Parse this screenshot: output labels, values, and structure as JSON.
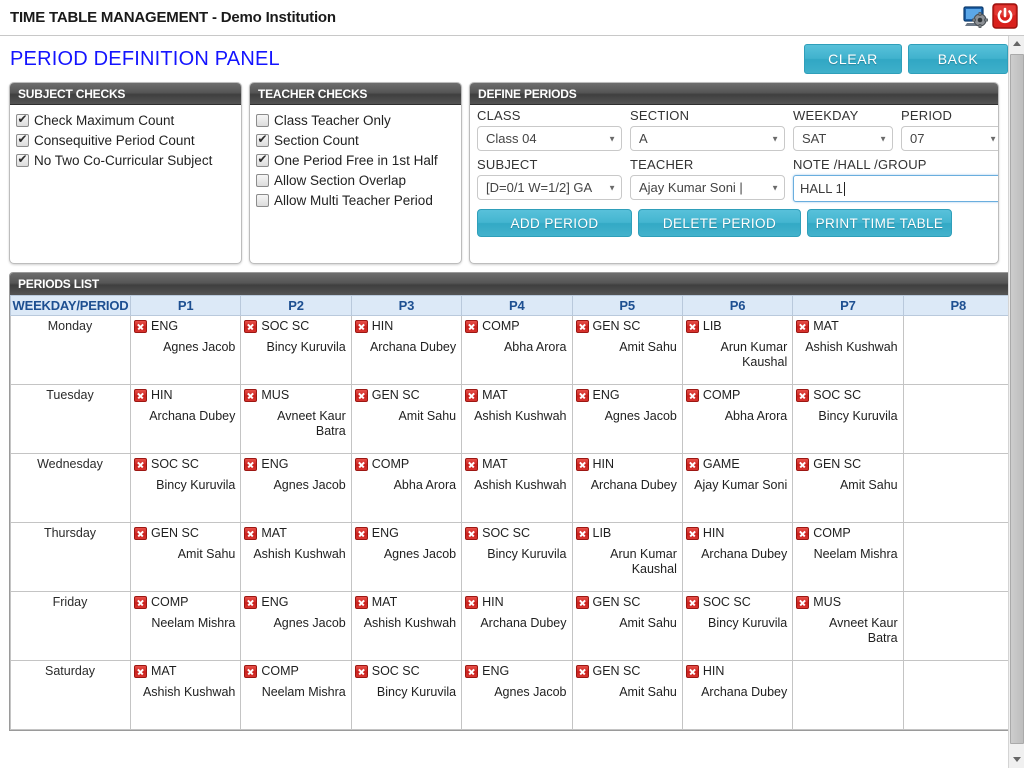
{
  "titlebar": {
    "app_title": "TIME TABLE MANAGEMENT - Demo Institution",
    "settings_icon": "settings-monitor-icon",
    "power_icon": "power-icon"
  },
  "header": {
    "page_title": "PERIOD DEFINITION PANEL",
    "clear_label": "CLEAR",
    "back_label": "BACK",
    "button_color": "#3fb0ca"
  },
  "subject_checks": {
    "title": "SUBJECT CHECKS",
    "items": [
      {
        "label": "Check Maximum Count",
        "checked": true
      },
      {
        "label": "Consequitive Period Count",
        "checked": true
      },
      {
        "label": "No Two Co-Curricular Subject",
        "checked": true
      }
    ]
  },
  "teacher_checks": {
    "title": "TEACHER CHECKS",
    "items": [
      {
        "label": "Class Teacher Only",
        "checked": false
      },
      {
        "label": "Section Count",
        "checked": true
      },
      {
        "label": "One Period Free in 1st Half",
        "checked": true
      },
      {
        "label": "Allow Section Overlap",
        "checked": false
      },
      {
        "label": "Allow Multi Teacher Period",
        "checked": false
      }
    ]
  },
  "define_periods": {
    "title": "DEFINE PERIODS",
    "fields": {
      "class_label": "CLASS",
      "class_value": "Class 04",
      "section_label": "SECTION",
      "section_value": "A",
      "weekday_label": "WEEKDAY",
      "weekday_value": "SAT",
      "period_label": "PERIOD",
      "period_value": "07",
      "subject_label": "SUBJECT",
      "subject_value": "[D=0/1 W=1/2] GA",
      "teacher_label": "TEACHER",
      "teacher_value": "Ajay Kumar Soni |",
      "note_label": "NOTE /HALL /GROUP",
      "note_value": "HALL 1"
    },
    "buttons": {
      "add": "ADD PERIOD",
      "delete": "DELETE PERIOD",
      "print": "PRINT TIME TABLE"
    }
  },
  "periods_list": {
    "title": "PERIODS LIST",
    "columns": [
      "WEEKDAY/PERIOD",
      "P1",
      "P2",
      "P3",
      "P4",
      "P5",
      "P6",
      "P7",
      "P8"
    ],
    "rows": [
      {
        "day": "Monday",
        "cells": [
          {
            "subject": "ENG",
            "teacher": "Agnes Jacob"
          },
          {
            "subject": "SOC SC",
            "teacher": "Bincy Kuruvila"
          },
          {
            "subject": "HIN",
            "teacher": "Archana Dubey"
          },
          {
            "subject": "COMP",
            "teacher": "Abha Arora"
          },
          {
            "subject": "GEN SC",
            "teacher": "Amit Sahu"
          },
          {
            "subject": "LIB",
            "teacher": "Arun Kumar Kaushal"
          },
          {
            "subject": "MAT",
            "teacher": "Ashish Kushwah"
          },
          null
        ]
      },
      {
        "day": "Tuesday",
        "cells": [
          {
            "subject": "HIN",
            "teacher": "Archana Dubey"
          },
          {
            "subject": "MUS",
            "teacher": "Avneet Kaur Batra"
          },
          {
            "subject": "GEN SC",
            "teacher": "Amit Sahu"
          },
          {
            "subject": "MAT",
            "teacher": "Ashish Kushwah"
          },
          {
            "subject": "ENG",
            "teacher": "Agnes Jacob"
          },
          {
            "subject": "COMP",
            "teacher": "Abha Arora"
          },
          {
            "subject": "SOC SC",
            "teacher": "Bincy Kuruvila"
          },
          null
        ]
      },
      {
        "day": "Wednesday",
        "cells": [
          {
            "subject": "SOC SC",
            "teacher": "Bincy Kuruvila"
          },
          {
            "subject": "ENG",
            "teacher": "Agnes Jacob"
          },
          {
            "subject": "COMP",
            "teacher": "Abha Arora"
          },
          {
            "subject": "MAT",
            "teacher": "Ashish Kushwah"
          },
          {
            "subject": "HIN",
            "teacher": "Archana Dubey"
          },
          {
            "subject": "GAME",
            "teacher": "Ajay Kumar Soni"
          },
          {
            "subject": "GEN SC",
            "teacher": "Amit Sahu"
          },
          null
        ]
      },
      {
        "day": "Thursday",
        "cells": [
          {
            "subject": "GEN SC",
            "teacher": "Amit Sahu"
          },
          {
            "subject": "MAT",
            "teacher": "Ashish Kushwah"
          },
          {
            "subject": "ENG",
            "teacher": "Agnes Jacob"
          },
          {
            "subject": "SOC SC",
            "teacher": "Bincy Kuruvila"
          },
          {
            "subject": "LIB",
            "teacher": "Arun Kumar Kaushal"
          },
          {
            "subject": "HIN",
            "teacher": "Archana Dubey"
          },
          {
            "subject": "COMP",
            "teacher": "Neelam Mishra"
          },
          null
        ]
      },
      {
        "day": "Friday",
        "cells": [
          {
            "subject": "COMP",
            "teacher": "Neelam Mishra"
          },
          {
            "subject": "ENG",
            "teacher": "Agnes Jacob"
          },
          {
            "subject": "MAT",
            "teacher": "Ashish Kushwah"
          },
          {
            "subject": "HIN",
            "teacher": "Archana Dubey"
          },
          {
            "subject": "GEN SC",
            "teacher": "Amit Sahu"
          },
          {
            "subject": "SOC SC",
            "teacher": "Bincy Kuruvila"
          },
          {
            "subject": "MUS",
            "teacher": "Avneet Kaur Batra"
          },
          null
        ]
      },
      {
        "day": "Saturday",
        "cells": [
          {
            "subject": "MAT",
            "teacher": "Ashish Kushwah"
          },
          {
            "subject": "COMP",
            "teacher": "Neelam Mishra"
          },
          {
            "subject": "SOC SC",
            "teacher": "Bincy Kuruvila"
          },
          {
            "subject": "ENG",
            "teacher": "Agnes Jacob"
          },
          {
            "subject": "GEN SC",
            "teacher": "Amit Sahu"
          },
          {
            "subject": "HIN",
            "teacher": "Archana Dubey"
          },
          null,
          null
        ]
      }
    ]
  }
}
